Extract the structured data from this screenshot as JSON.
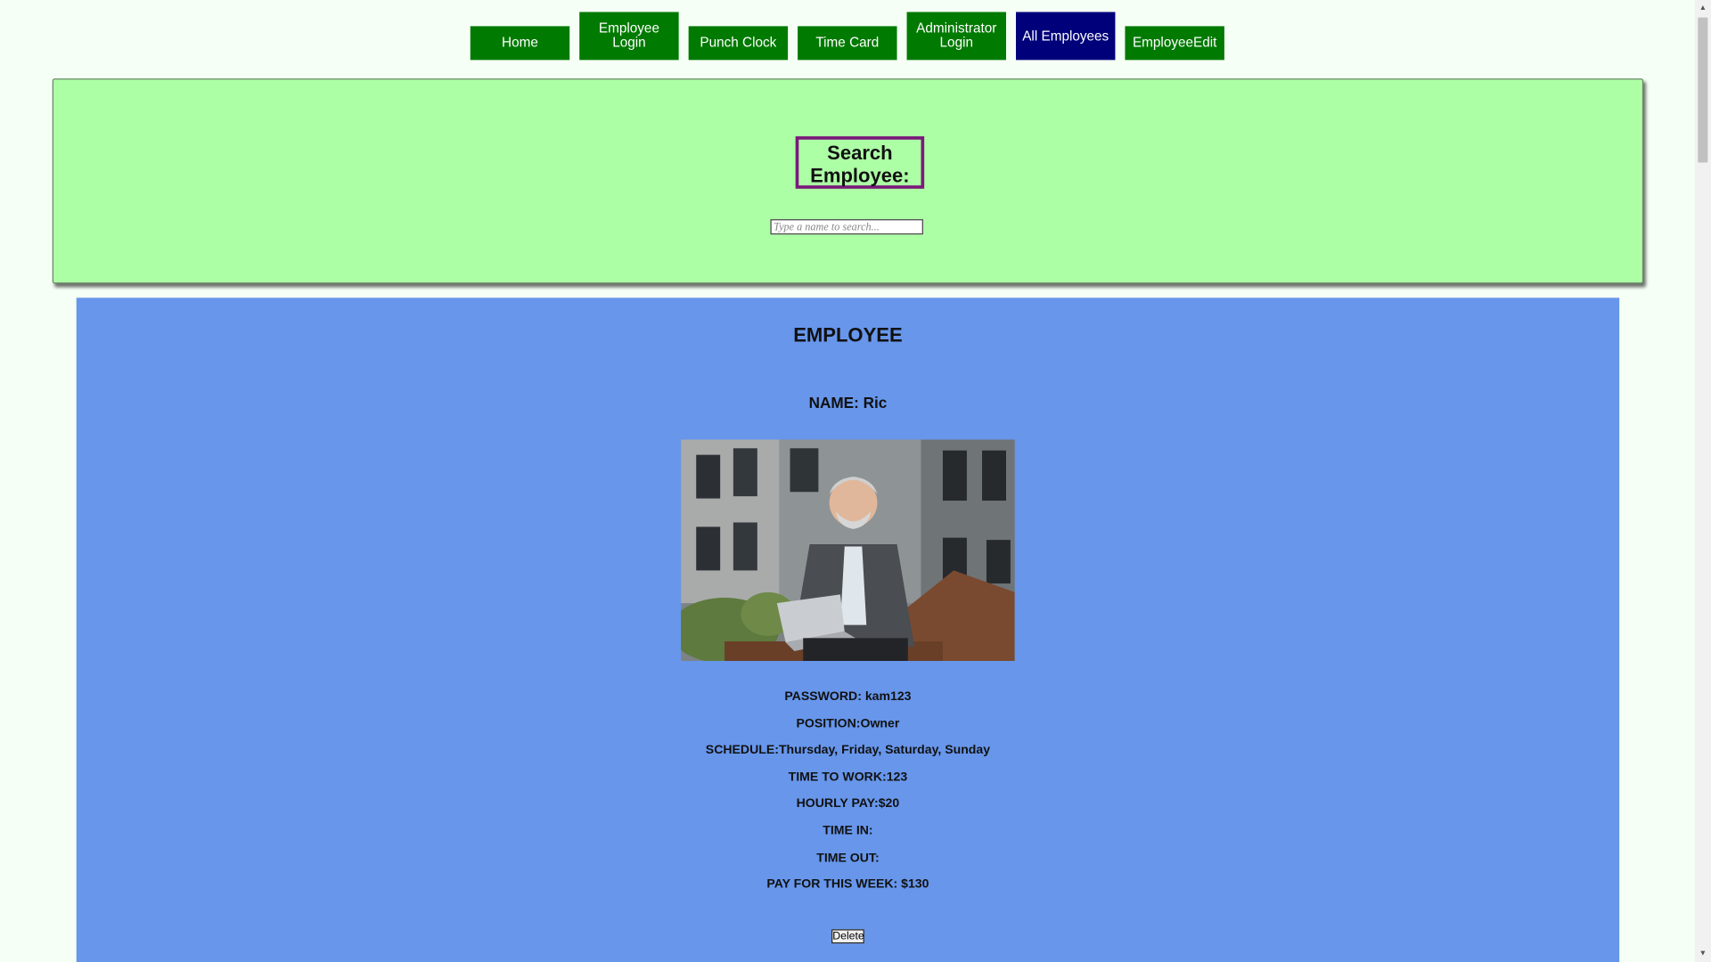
{
  "nav": {
    "items": [
      {
        "label": "Home"
      },
      {
        "label": "Employee Login"
      },
      {
        "label": "Punch Clock"
      },
      {
        "label": "Time Card"
      },
      {
        "label": "Administrator Login"
      },
      {
        "label": "All Employees",
        "active": true
      },
      {
        "label": "EmployeeEdit"
      }
    ]
  },
  "search": {
    "title": "Search Employee:",
    "placeholder": "Type a name to search..."
  },
  "employee": {
    "heading": "EMPLOYEE",
    "name": "NAME: Ric",
    "password": "PASSWORD: kam123",
    "position": "POSITION:Owner",
    "schedule": "SCHEDULE:Thursday, Friday, Saturday, Sunday",
    "time_to_work": "TIME TO WORK:123",
    "hourly_pay": "HOURLY PAY:$20",
    "time_in": "TIME IN:",
    "time_out": "TIME OUT:",
    "pay_week": "PAY FOR THIS WEEK: $130",
    "delete_label": "Delete"
  },
  "colors": {
    "nav_green": "#007a00",
    "nav_active": "#00007a",
    "search_bg": "#adffa6",
    "employee_bg": "#6796eb",
    "search_border": "#7a1a7a"
  }
}
